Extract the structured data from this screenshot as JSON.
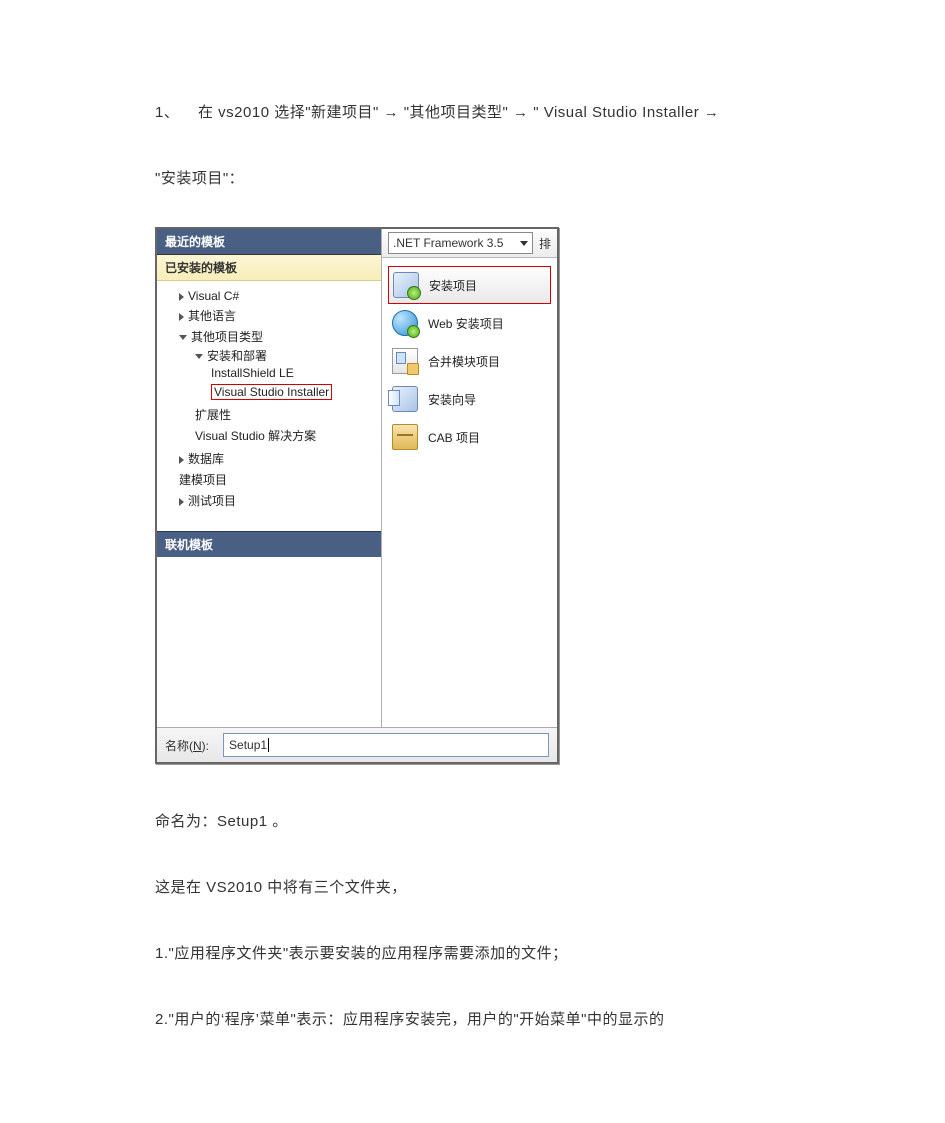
{
  "para1_prefix": "1、",
  "para1_text": "在 vs2010 选择\"新建项目\"",
  "para1_seg2": "\"其他项目类型\"",
  "para1_seg3": "\" Visual Studio Installer",
  "arrow": "→",
  "para2": "\"安装项目\"：",
  "dialog": {
    "recent_header": "最近的模板",
    "installed_header": "已安装的模板",
    "online_header": "联机模板",
    "combo_label": ".NET Framework 3.5",
    "sort_trail": "排",
    "tree": {
      "n0": "Visual C#",
      "n1": "其他语言",
      "n2": "其他项目类型",
      "n2a": "安装和部署",
      "n2a1": "InstallShield LE",
      "n2a2": "Visual Studio Installer",
      "n2b": "扩展性",
      "n2c": "Visual Studio 解决方案",
      "n3": "数据库",
      "n4": "建模项目",
      "n5": "测试项目"
    },
    "templates": {
      "t0": "安装项目",
      "t1": "Web 安装项目",
      "t2": "合并模块项目",
      "t3": "安装向导",
      "t4": "CAB 项目"
    },
    "name_label_pre": "名称(",
    "name_label_u": "N",
    "name_label_post": "):",
    "name_value": "Setup1"
  },
  "para3": "命名为：Setup1 。",
  "para4": "这是在 VS2010 中将有三个文件夹，",
  "para5": "1.\"应用程序文件夹\"表示要安装的应用程序需要添加的文件；",
  "para6": "2.\"用户的‘程序’菜单\"表示：应用程序安装完，用户的\"开始菜单\"中的显示的"
}
